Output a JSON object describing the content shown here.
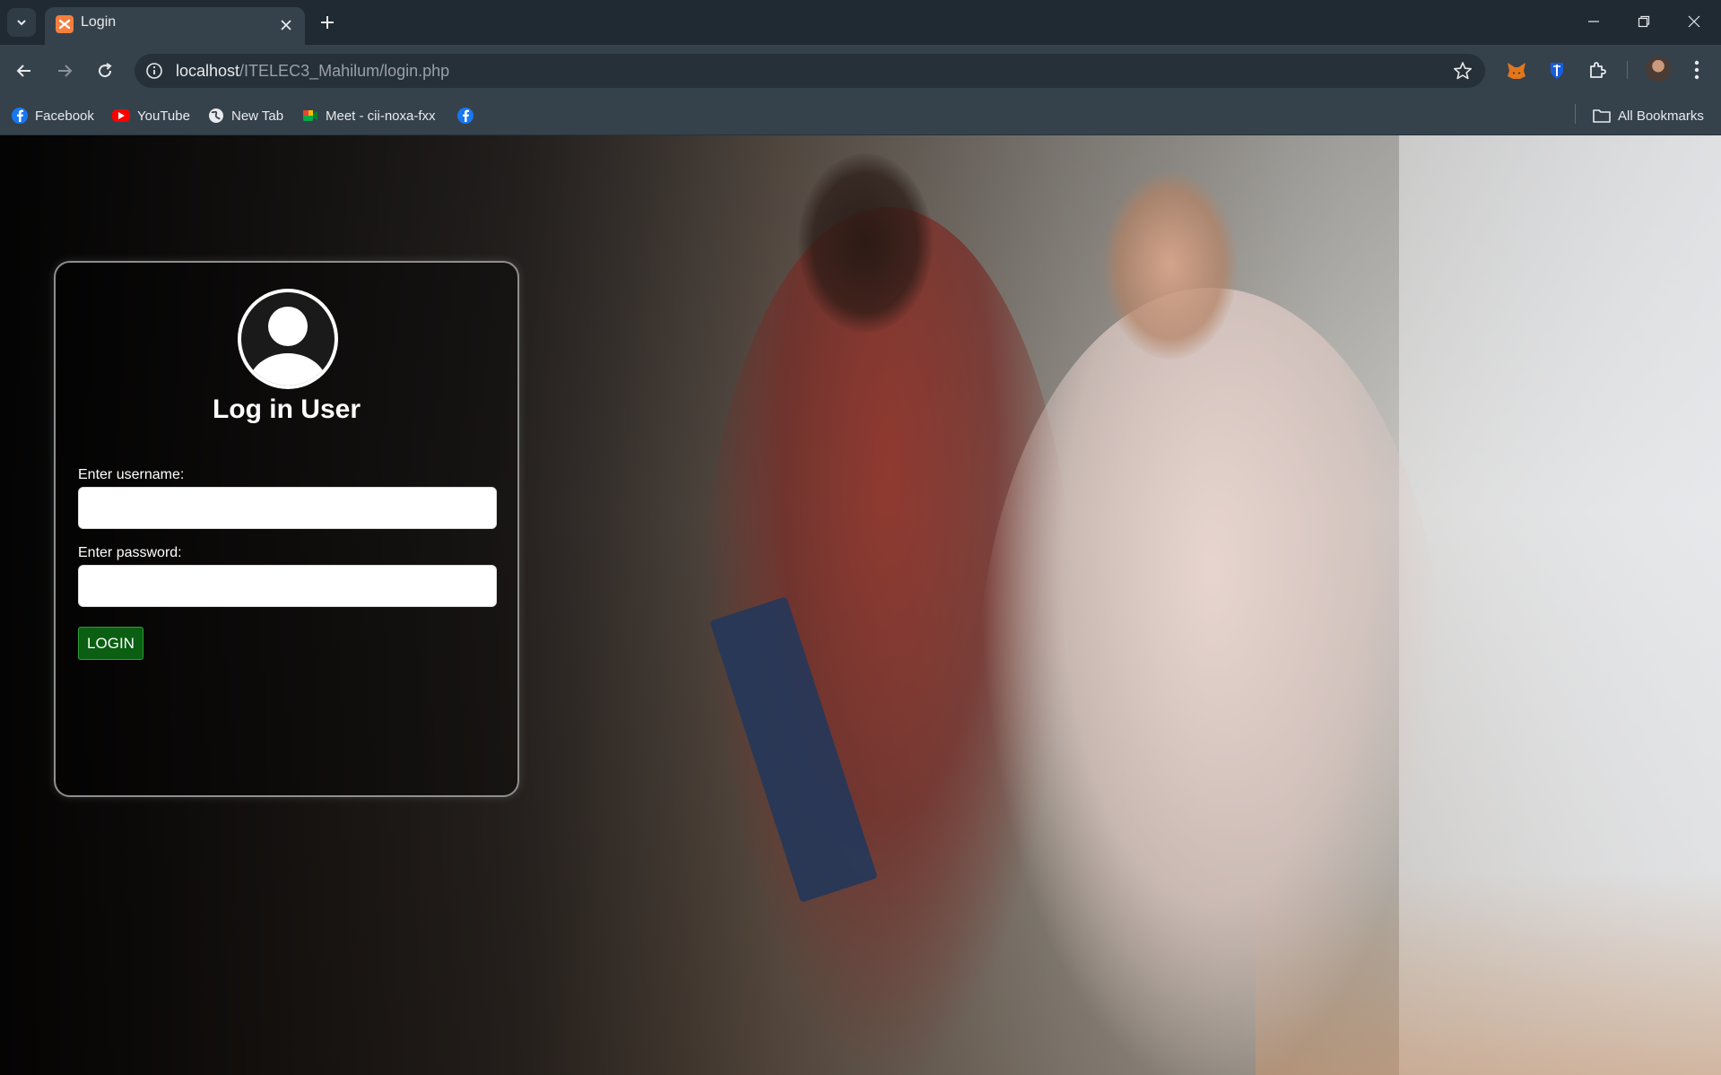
{
  "browser": {
    "tab": {
      "title": "Login",
      "favicon": "xampp-icon"
    },
    "address_bar": {
      "host": "localhost",
      "path": "/ITELEC3_Mahilum/login.php"
    },
    "bookmarks": [
      {
        "label": "Facebook",
        "icon": "facebook-icon",
        "color": "#1877f2"
      },
      {
        "label": "YouTube",
        "icon": "youtube-icon",
        "color": "#ff0000"
      },
      {
        "label": "New Tab",
        "icon": "globe-icon",
        "color": "#e8eaed"
      },
      {
        "label": "Meet - cii-noxa-fxx",
        "icon": "google-meet-icon",
        "color": "#34a853"
      },
      {
        "label": "",
        "icon": "facebook-icon",
        "color": "#1877f2"
      }
    ],
    "all_bookmarks": "All Bookmarks"
  },
  "login": {
    "title": "Log in User",
    "username_label": "Enter username:",
    "username_value": "",
    "password_label": "Enter password:",
    "password_value": "",
    "button_label": "LOGIN",
    "button_color": "#0a5f12"
  }
}
